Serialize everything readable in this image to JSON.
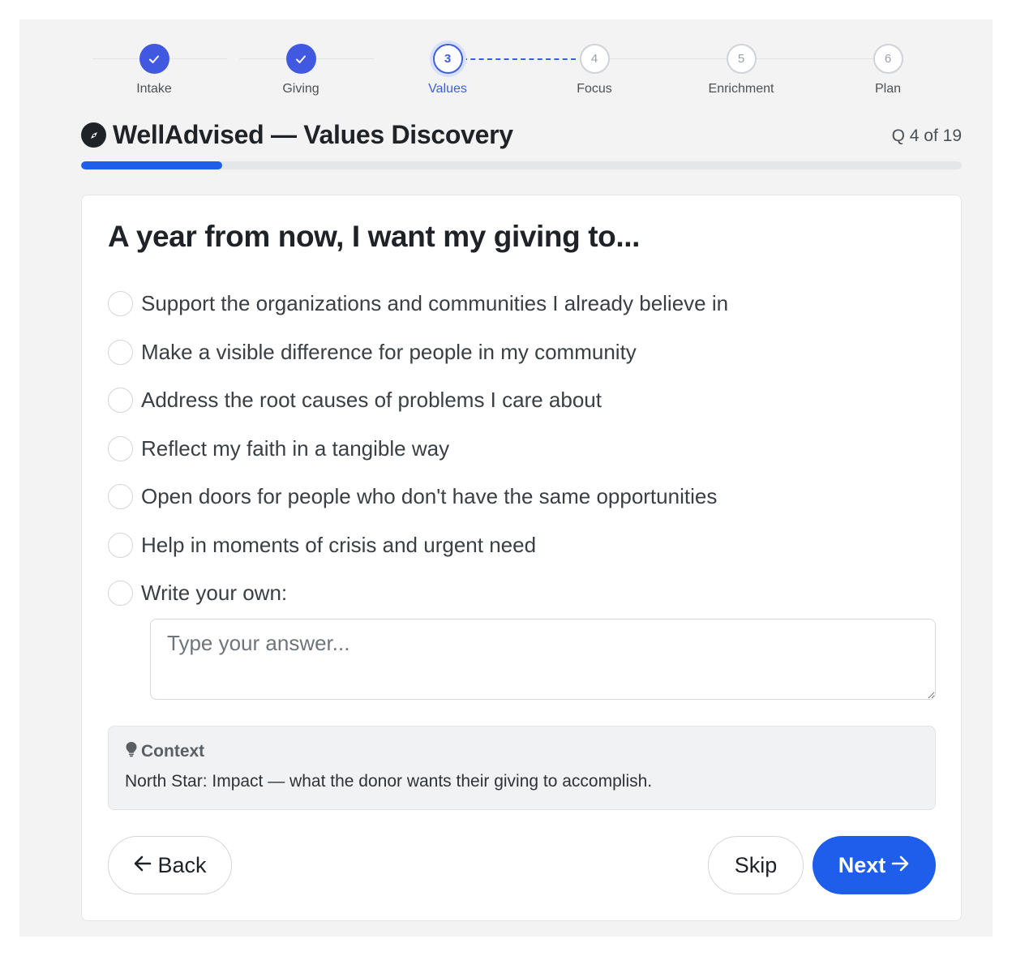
{
  "stepper": {
    "steps": [
      {
        "label": "Intake",
        "number": "1",
        "status": "completed"
      },
      {
        "label": "Giving",
        "number": "2",
        "status": "completed"
      },
      {
        "label": "Values",
        "number": "3",
        "status": "current"
      },
      {
        "label": "Focus",
        "number": "4",
        "status": "upcoming"
      },
      {
        "label": "Enrichment",
        "number": "5",
        "status": "upcoming"
      },
      {
        "label": "Plan",
        "number": "6",
        "status": "upcoming"
      }
    ]
  },
  "header": {
    "title": "WellAdvised — Values Discovery",
    "question_count": "Q 4 of 19",
    "progress_fraction": 0.16
  },
  "question": {
    "title": "A year from now, I want my giving to...",
    "options": [
      "Support the organizations and communities I already believe in",
      "Make a visible difference for people in my community",
      "Address the root causes of problems I care about",
      "Reflect my faith in a tangible way",
      "Open doors for people who don't have the same opportunities",
      "Help in moments of crisis and urgent need",
      "Write your own:"
    ],
    "answer_placeholder": "Type your answer...",
    "answer_value": ""
  },
  "context": {
    "icon": "lightbulb-icon",
    "title": "Context",
    "text": "North Star: Impact — what the donor wants their giving to accomplish."
  },
  "buttons": {
    "back": "Back",
    "skip": "Skip",
    "next": "Next"
  },
  "colors": {
    "accent": "#1e5eea",
    "stepper_accent": "#3e5ee0",
    "background": "#f2f3f2"
  }
}
